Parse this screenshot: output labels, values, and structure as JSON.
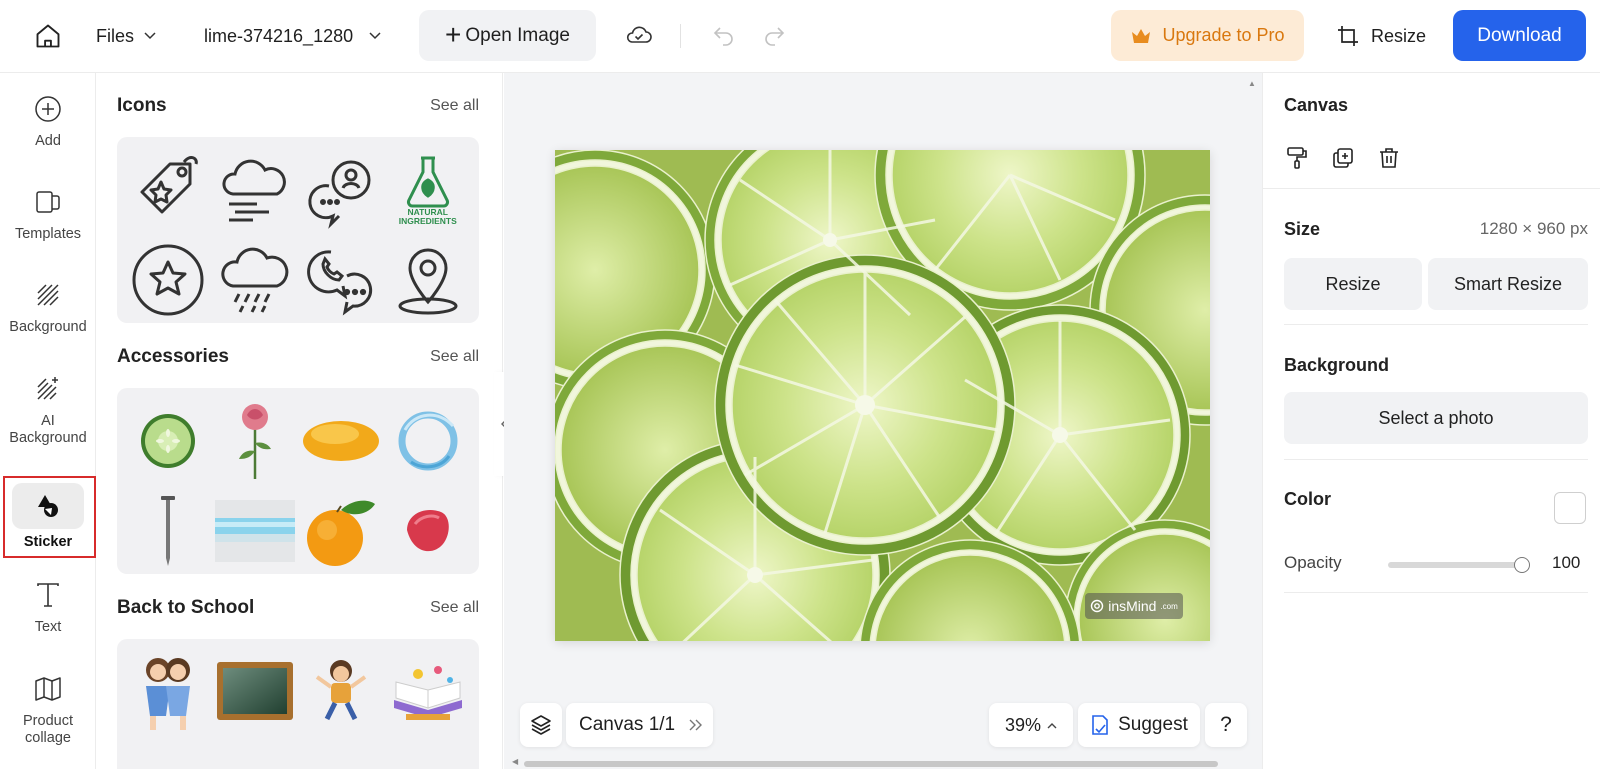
{
  "topbar": {
    "files_label": "Files",
    "filename": "lime-374216_1280",
    "open_image_label": "Open Image",
    "upgrade_label": "Upgrade to Pro",
    "resize_label": "Resize",
    "download_label": "Download",
    "accent_color": "#2563eb",
    "upgrade_color": "#d9780f"
  },
  "rail": {
    "items": [
      {
        "label": "Add",
        "icon": "plus-circle-icon"
      },
      {
        "label": "Templates",
        "icon": "templates-icon"
      },
      {
        "label": "Background",
        "icon": "hatch-icon"
      },
      {
        "label": "AI Background",
        "icon": "ai-hatch-icon"
      },
      {
        "label": "Sticker",
        "icon": "sticker-icon",
        "active": true
      },
      {
        "label": "Text",
        "icon": "text-icon"
      },
      {
        "label": "Product collage",
        "icon": "map-icon"
      }
    ]
  },
  "panel": {
    "sections": [
      {
        "title": "Icons",
        "see_all": "See all"
      },
      {
        "title": "Accessories",
        "see_all": "See all"
      },
      {
        "title": "Back to School",
        "see_all": "See all"
      }
    ],
    "icons_badge_text": "NATURAL INGREDIENTS"
  },
  "canvas": {
    "watermark": "insMind",
    "watermark_suffix": ".com",
    "pager_label": "Canvas 1/1",
    "zoom": "39%",
    "suggest_label": "Suggest",
    "help_label": "?"
  },
  "props": {
    "canvas_title": "Canvas",
    "size_title": "Size",
    "size_value": "1280 × 960 px",
    "resize_label": "Resize",
    "smart_resize_label": "Smart Resize",
    "background_title": "Background",
    "select_photo_label": "Select a photo",
    "color_title": "Color",
    "opacity_label": "Opacity",
    "opacity_value": "100",
    "opacity_fraction": 1.0
  }
}
